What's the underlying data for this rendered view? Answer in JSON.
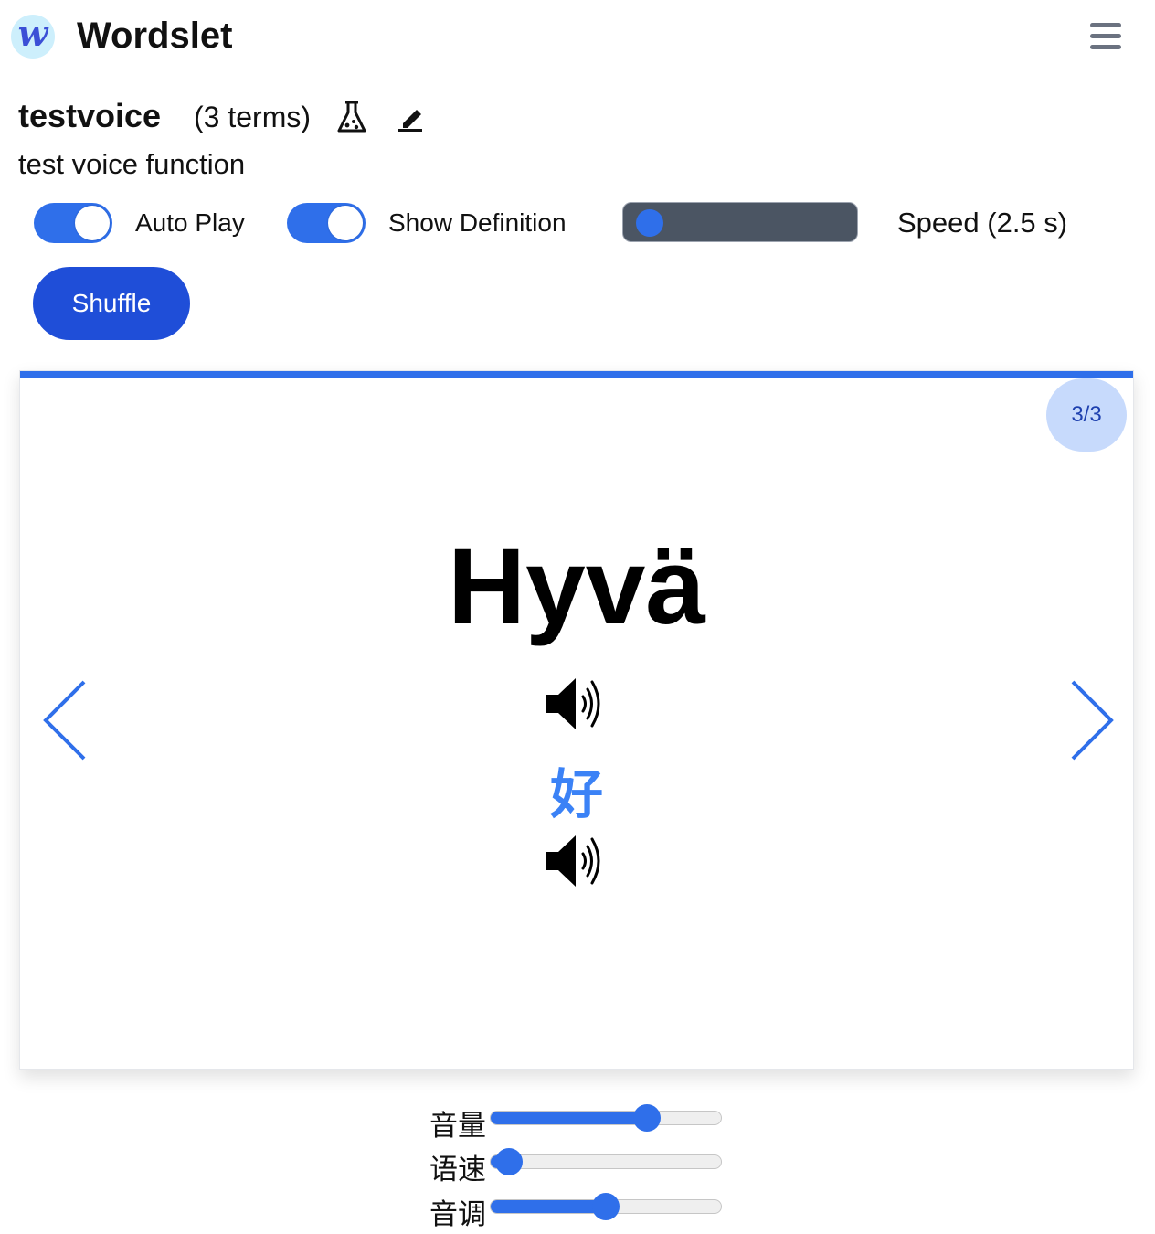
{
  "app": {
    "logo_letter": "w",
    "name": "Wordslet"
  },
  "set": {
    "title": "testvoice",
    "term_count": "(3 terms)",
    "description": "test voice function"
  },
  "controls": {
    "auto_play": {
      "label": "Auto Play",
      "on": true
    },
    "show_definition": {
      "label": "Show Definition",
      "on": true
    },
    "speed": {
      "label": "Speed (2.5 s)",
      "value_seconds": 2.5,
      "level": 0.0
    },
    "shuffle_label": "Shuffle"
  },
  "card": {
    "counter": "3/3",
    "progress": 1.0,
    "term": "Hyvä",
    "definition": "好"
  },
  "voice_settings": [
    {
      "label": "音量",
      "level": 0.68
    },
    {
      "label": "语速",
      "level": 0.08
    },
    {
      "label": "音调",
      "level": 0.5
    }
  ],
  "icons": {
    "logo": "wordslet-logo-icon",
    "menu": "hamburger-menu-icon",
    "test": "flask-icon",
    "edit": "pencil-icon",
    "audio": "speaker-icon",
    "prev": "chevron-left-icon",
    "next": "chevron-right-icon"
  },
  "colors": {
    "accent": "#2f6fea",
    "button": "#1f4ed8",
    "definition": "#3b82f6",
    "badge_bg": "#c7dafc",
    "badge_text": "#1e40af"
  }
}
